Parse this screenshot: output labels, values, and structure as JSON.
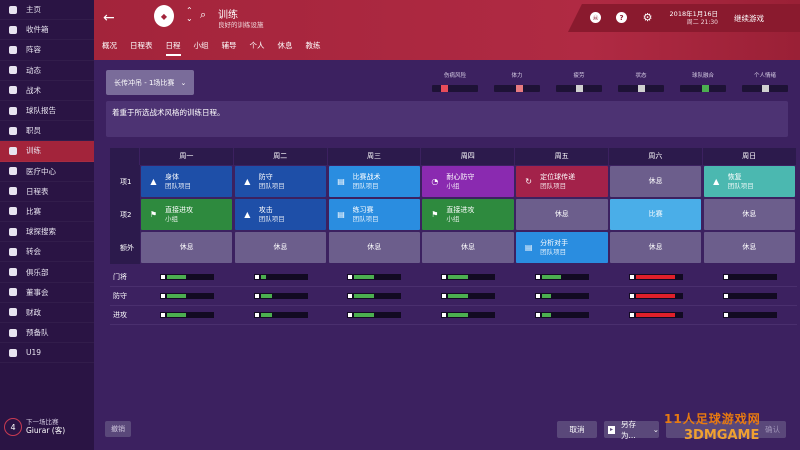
{
  "sidebar": {
    "items": [
      {
        "label": "主页",
        "icon": "home-icon"
      },
      {
        "label": "收件箱",
        "icon": "inbox-icon"
      },
      {
        "label": "阵容",
        "icon": "squad-icon"
      },
      {
        "label": "动态",
        "icon": "dynamics-icon"
      },
      {
        "label": "战术",
        "icon": "tactics-icon"
      },
      {
        "label": "球队报告",
        "icon": "report-icon"
      },
      {
        "label": "职员",
        "icon": "staff-icon"
      },
      {
        "label": "训练",
        "icon": "training-icon"
      },
      {
        "label": "医疗中心",
        "icon": "medical-icon"
      },
      {
        "label": "日程表",
        "icon": "calendar-icon"
      },
      {
        "label": "比赛",
        "icon": "match-icon"
      },
      {
        "label": "球探搜索",
        "icon": "scouting-icon"
      },
      {
        "label": "转会",
        "icon": "transfers-icon"
      },
      {
        "label": "俱乐部",
        "icon": "club-icon"
      },
      {
        "label": "董事会",
        "icon": "board-icon"
      },
      {
        "label": "财政",
        "icon": "finances-icon"
      },
      {
        "label": "预备队",
        "icon": "reserves-icon"
      },
      {
        "label": "U19",
        "icon": "u19-icon"
      }
    ],
    "active_index": 7,
    "next_match": {
      "days": "4",
      "label": "下一场比赛",
      "opponent": "Giurar (客)"
    }
  },
  "header": {
    "title": "训练",
    "subtitle": "良好的训练设施",
    "tabs": [
      "概况",
      "日程表",
      "日程",
      "小组",
      "辅导",
      "个人",
      "休息",
      "教练"
    ],
    "active_tab": 2,
    "date": "2018年1月16日",
    "time": "周二 21:30",
    "continue_label": "继续游戏"
  },
  "plan_select": {
    "value": "长传冲吊 - 1场比赛"
  },
  "meters": [
    {
      "label": "伤病风险",
      "color": "#e84c5a",
      "level": 0.28
    },
    {
      "label": "体力",
      "color": "#e87a80",
      "level": 0.55
    },
    {
      "label": "疲劳",
      "color": "#d0d0d0",
      "level": 0.5
    },
    {
      "label": "状态",
      "color": "#d0d0d0",
      "level": 0.5
    },
    {
      "label": "球队融合",
      "color": "#4caf50",
      "level": 0.55
    },
    {
      "label": "个人情绪",
      "color": "#d0d0d0",
      "level": 0.5
    }
  ],
  "description": "着重于所选战术风格的训练日程。",
  "schedule": {
    "days": [
      "周一",
      "周二",
      "周三",
      "周四",
      "周五",
      "周六",
      "周日"
    ],
    "rows": [
      {
        "label": "项1",
        "cells": [
          {
            "title": "身体",
            "sub": "团队项目",
            "color": "#1e4fa8",
            "icon": "cone-icon",
            "glyph": "▲"
          },
          {
            "title": "防守",
            "sub": "团队项目",
            "color": "#1e4fa8",
            "icon": "cone-icon",
            "glyph": "▲"
          },
          {
            "title": "比赛战术",
            "sub": "团队项目",
            "color": "#2a8de0",
            "icon": "clipboard-icon",
            "glyph": "▤"
          },
          {
            "title": "耐心防守",
            "sub": "小组",
            "color": "#8a2ab0",
            "icon": "stopwatch-icon",
            "glyph": "◔"
          },
          {
            "title": "定位球传递",
            "sub": "团队项目",
            "color": "#a3224a",
            "icon": "setpiece-icon",
            "glyph": "↻"
          },
          {
            "title": "休息",
            "sub": "",
            "color": "#6c5e8c",
            "icon": "",
            "glyph": ""
          },
          {
            "title": "恢复",
            "sub": "团队项目",
            "color": "#4bb8b0",
            "icon": "cone-icon",
            "glyph": "▲"
          }
        ]
      },
      {
        "label": "项2",
        "cells": [
          {
            "title": "直接进攻",
            "sub": "小组",
            "color": "#2e8a3e",
            "icon": "runner-icon",
            "glyph": "⚑"
          },
          {
            "title": "攻击",
            "sub": "团队项目",
            "color": "#1e4fa8",
            "icon": "cone-icon",
            "glyph": "▲"
          },
          {
            "title": "练习赛",
            "sub": "团队项目",
            "color": "#2a8de0",
            "icon": "clipboard-icon",
            "glyph": "▤"
          },
          {
            "title": "直接进攻",
            "sub": "小组",
            "color": "#2e8a3e",
            "icon": "runner-icon",
            "glyph": "⚑"
          },
          {
            "title": "休息",
            "sub": "",
            "color": "#6c5e8c",
            "icon": "",
            "glyph": ""
          },
          {
            "title": "比赛",
            "sub": "",
            "color": "#4aaee8",
            "icon": "",
            "glyph": ""
          },
          {
            "title": "休息",
            "sub": "",
            "color": "#6c5e8c",
            "icon": "",
            "glyph": ""
          }
        ]
      },
      {
        "label": "额外",
        "cells": [
          {
            "title": "休息",
            "sub": "",
            "color": "#6c5e8c",
            "icon": "",
            "glyph": ""
          },
          {
            "title": "休息",
            "sub": "",
            "color": "#6c5e8c",
            "icon": "",
            "glyph": ""
          },
          {
            "title": "休息",
            "sub": "",
            "color": "#6c5e8c",
            "icon": "",
            "glyph": ""
          },
          {
            "title": "休息",
            "sub": "",
            "color": "#6c5e8c",
            "icon": "",
            "glyph": ""
          },
          {
            "title": "分析对手",
            "sub": "团队项目",
            "color": "#2a8de0",
            "icon": "clipboard-icon",
            "glyph": "▤"
          },
          {
            "title": "休息",
            "sub": "",
            "color": "#6c5e8c",
            "icon": "",
            "glyph": ""
          },
          {
            "title": "休息",
            "sub": "",
            "color": "#6c5e8c",
            "icon": "",
            "glyph": ""
          }
        ]
      }
    ]
  },
  "loads": [
    {
      "label": "门将",
      "bars": [
        {
          "fill": 0.42,
          "color": "#4caf50"
        },
        {
          "fill": 0.12,
          "color": "#4caf50"
        },
        {
          "fill": 0.42,
          "color": "#4caf50"
        },
        {
          "fill": 0.42,
          "color": "#4caf50"
        },
        {
          "fill": 0.42,
          "color": "#4caf50"
        },
        {
          "fill": 0.85,
          "color": "#e0202a"
        },
        {
          "fill": 0.0,
          "color": "#4caf50"
        }
      ]
    },
    {
      "label": "防守",
      "bars": [
        {
          "fill": 0.42,
          "color": "#4caf50"
        },
        {
          "fill": 0.25,
          "color": "#4caf50"
        },
        {
          "fill": 0.42,
          "color": "#4caf50"
        },
        {
          "fill": 0.42,
          "color": "#4caf50"
        },
        {
          "fill": 0.2,
          "color": "#4caf50"
        },
        {
          "fill": 0.85,
          "color": "#e0202a"
        },
        {
          "fill": 0.0,
          "color": "#4caf50"
        }
      ]
    },
    {
      "label": "进攻",
      "bars": [
        {
          "fill": 0.42,
          "color": "#4caf50"
        },
        {
          "fill": 0.25,
          "color": "#4caf50"
        },
        {
          "fill": 0.42,
          "color": "#4caf50"
        },
        {
          "fill": 0.42,
          "color": "#4caf50"
        },
        {
          "fill": 0.2,
          "color": "#4caf50"
        },
        {
          "fill": 0.85,
          "color": "#e0202a"
        },
        {
          "fill": 0.0,
          "color": "#4caf50"
        }
      ]
    }
  ],
  "buttons": {
    "undo": "撤销",
    "cancel": "取消",
    "save_as": "另存为...",
    "confirm": "确认"
  },
  "watermark": {
    "line1": "11人足球游戏网",
    "line2": "3DMGAME"
  }
}
